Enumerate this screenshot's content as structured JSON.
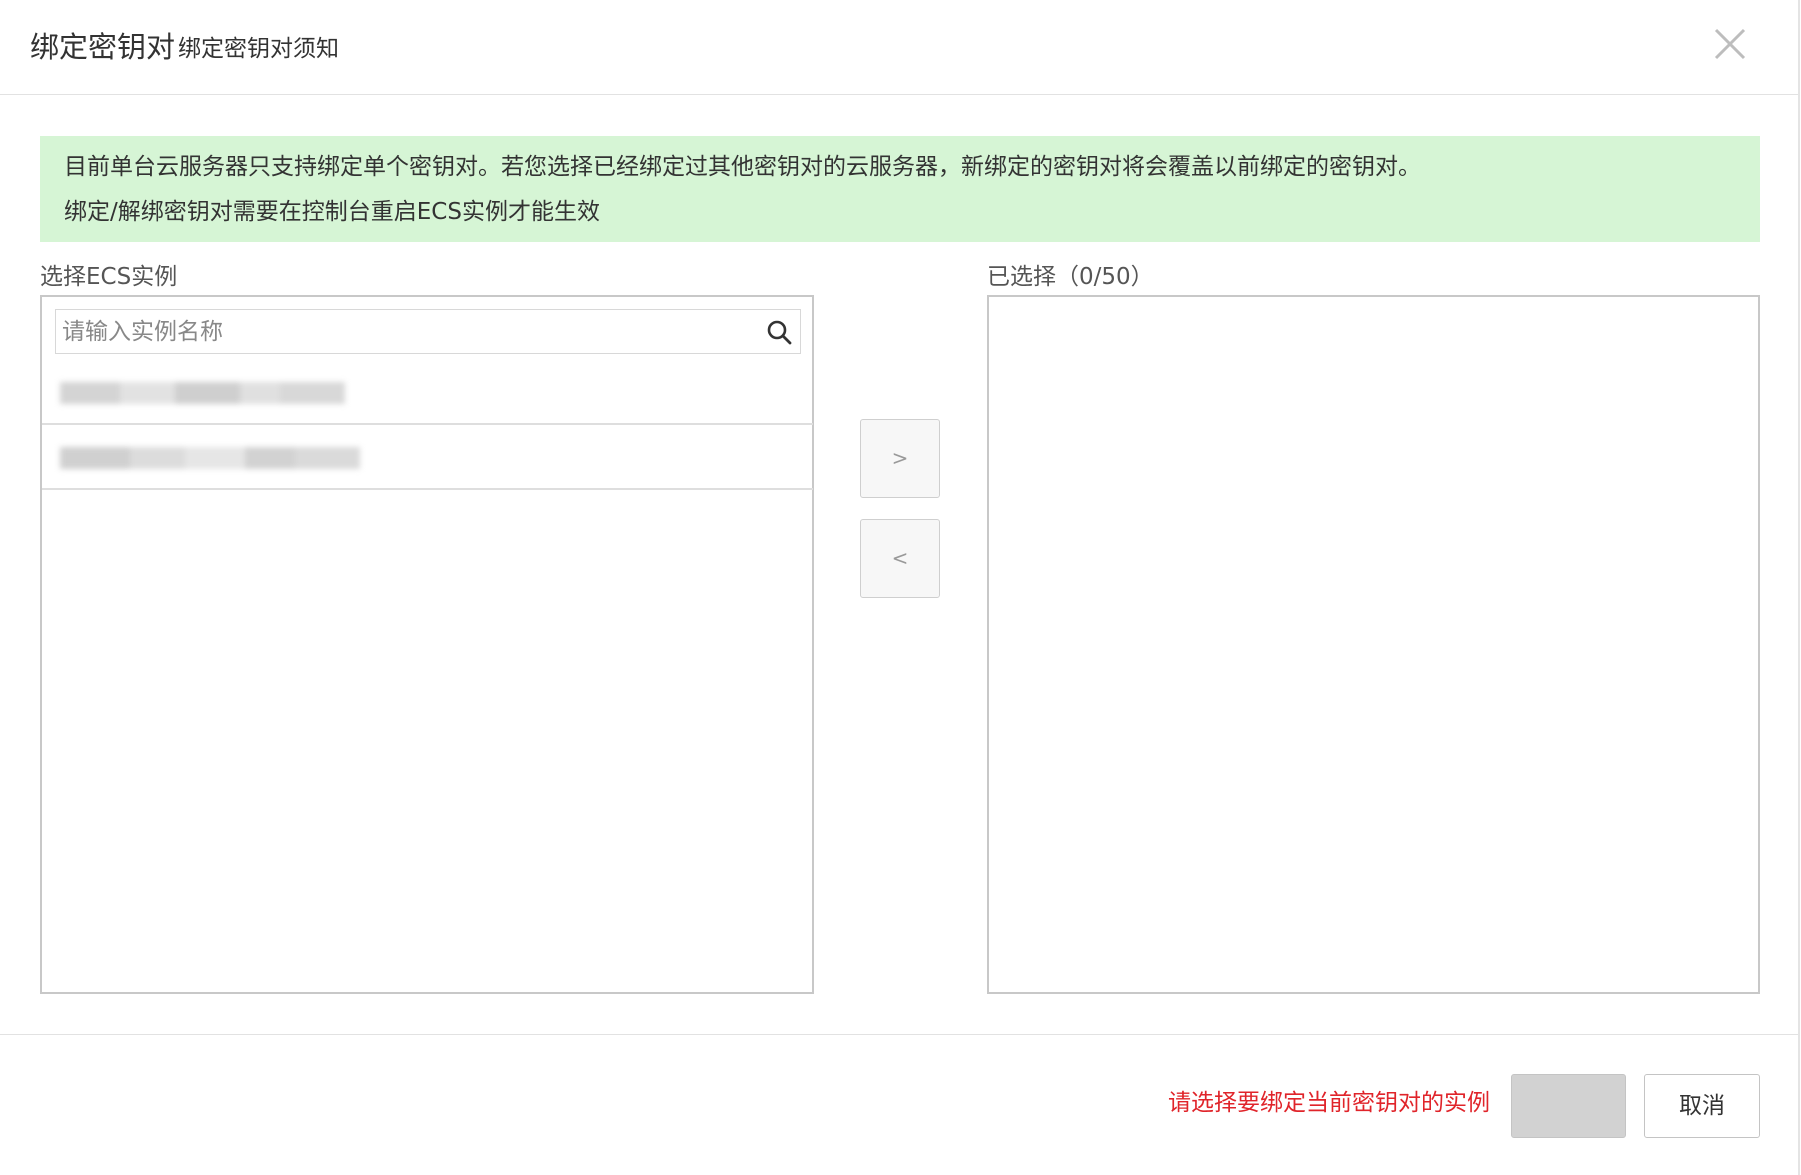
{
  "header": {
    "title": "绑定密钥对",
    "subtitle": "绑定密钥对须知"
  },
  "notice": {
    "line1": "目前单台云服务器只支持绑定单个密钥对。若您选择已经绑定过其他密钥对的云服务器，新绑定的密钥对将会覆盖以前绑定的密钥对。",
    "line2": "绑定/解绑密钥对需要在控制台重启ECS实例才能生效"
  },
  "left_panel": {
    "label": "选择ECS实例",
    "search_placeholder": "请输入实例名称",
    "search_value": "",
    "items": [
      {
        "name": "redacted-instance-1"
      },
      {
        "name": "redacted-instance-2"
      }
    ]
  },
  "right_panel": {
    "label": "已选择（0/50）",
    "items": []
  },
  "transfer": {
    "move_right_label": ">",
    "move_left_label": "<"
  },
  "footer": {
    "error_message": "请选择要绑定当前密钥对的实例",
    "confirm_label": "",
    "cancel_label": "取消"
  },
  "colors": {
    "notice_bg": "#d6f5d5",
    "error_text": "#e0242a",
    "disabled_button": "#d2d2d2"
  }
}
